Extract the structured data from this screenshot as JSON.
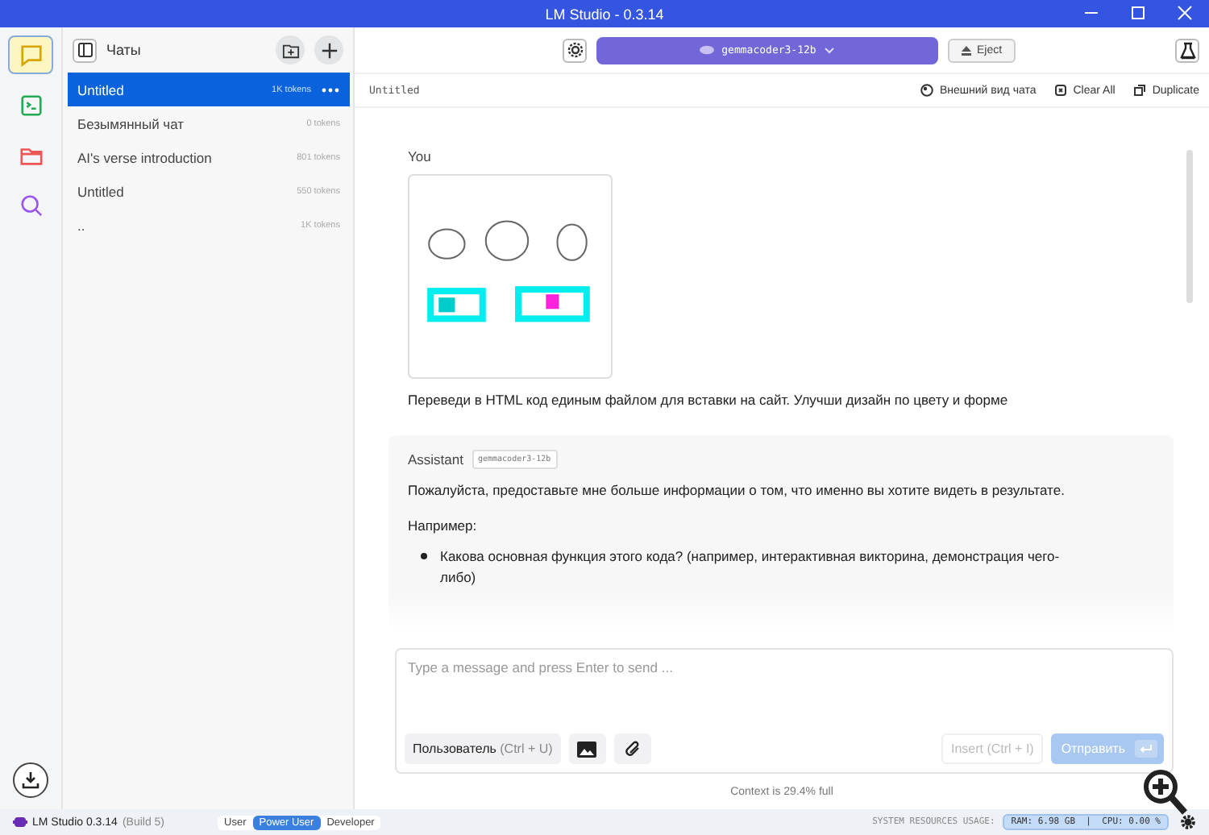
{
  "window": {
    "title": "LM Studio - 0.3.14"
  },
  "rail": [
    {
      "kind": "chat",
      "selected": true
    },
    {
      "kind": "terminal",
      "selected": false
    },
    {
      "kind": "folder",
      "selected": false
    },
    {
      "kind": "search",
      "selected": false
    }
  ],
  "sidebar": {
    "title": "Чаты",
    "chats": [
      {
        "title": "Untitled",
        "tokens": "1K tokens",
        "selected": true
      },
      {
        "title": "Безымянный чат",
        "tokens": "0 tokens",
        "selected": false
      },
      {
        "title": "AI's verse introduction",
        "tokens": "801 tokens",
        "selected": false
      },
      {
        "title": "Untitled",
        "tokens": "550 tokens",
        "selected": false
      },
      {
        "title": "..",
        "tokens": "1K tokens",
        "selected": false
      }
    ]
  },
  "toolbar": {
    "model": "gemmacoder3-12b",
    "eject": "Eject"
  },
  "chat_header": {
    "title": "Untitled",
    "actions": [
      {
        "kind": "palette",
        "label": "Внешний вид чата"
      },
      {
        "kind": "clear",
        "label": "Clear All"
      },
      {
        "kind": "duplicate",
        "label": "Duplicate"
      }
    ]
  },
  "messages": [
    {
      "role": "You",
      "kind": "user",
      "text": "Переведи в HTML код единым файлом для вставки на сайт. Улучши дизайн по цвету и форме"
    },
    {
      "role": "Assistant",
      "kind": "assistant",
      "model": "gemmacoder3-12b",
      "paragraphs": [
        "Пожалуйста, предоставьте мне больше информации о том, что именно вы хотите видеть в результате.",
        "Например:"
      ],
      "bullets": [
        "Какова основная функция этого кода? (например, интерактивная викторина, демонстрация чего-либо)"
      ]
    }
  ],
  "composer": {
    "placeholder": "Type a message and press Enter to send ...",
    "role_button": "Пользователь",
    "role_hint": "(Ctrl + U)",
    "insert": "Insert (Ctrl + I)",
    "insert_disabled": true,
    "send": "Отправить",
    "send_disabled": true
  },
  "context": "Context is 29.4% full",
  "status_bar": {
    "app": "LM Studio 0.3.14",
    "build": "(Build 5)",
    "modes": [
      {
        "label": "User",
        "selected": false
      },
      {
        "label": "Power User",
        "selected": true
      },
      {
        "label": "Developer",
        "selected": false
      }
    ],
    "resources_label": "SYSTEM RESOURCES USAGE:",
    "resources": "RAM: 6.98 GB  |  CPU: 0.00 %"
  }
}
